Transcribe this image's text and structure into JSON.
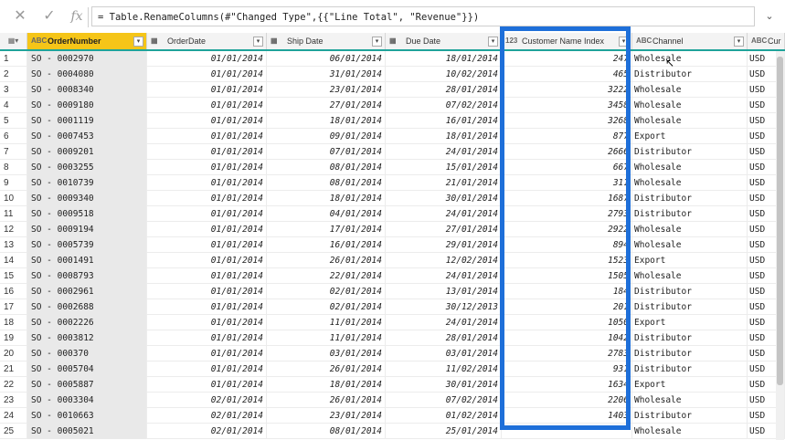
{
  "formula_bar": {
    "cancel_glyph": "✕",
    "confirm_glyph": "✓",
    "fx_label": "fx",
    "formula": "= Table.RenameColumns(#\"Changed Type\",{{\"Line Total\", \"Revenue\"}})",
    "expand_glyph": "⌄"
  },
  "columns": [
    {
      "type": "ABC",
      "label": "OrderNumber"
    },
    {
      "type": "▦",
      "label": "OrderDate"
    },
    {
      "type": "▦",
      "label": "Ship Date"
    },
    {
      "type": "▦",
      "label": "Due Date"
    },
    {
      "type": "123",
      "label": "Customer Name Index"
    },
    {
      "type": "ABC",
      "label": "Channel"
    },
    {
      "type": "ABC",
      "label": "Cur"
    }
  ],
  "rows": [
    {
      "n": "1",
      "order": "SO - 0002970",
      "od": "01/01/2014",
      "sd": "06/01/2014",
      "du": "18/01/2014",
      "cni": "247",
      "ch": "Wholesale",
      "cu": "USD"
    },
    {
      "n": "2",
      "order": "SO - 0004080",
      "od": "01/01/2014",
      "sd": "31/01/2014",
      "du": "10/02/2014",
      "cni": "465",
      "ch": "Distributor",
      "cu": "USD"
    },
    {
      "n": "3",
      "order": "SO - 0008340",
      "od": "01/01/2014",
      "sd": "23/01/2014",
      "du": "28/01/2014",
      "cni": "3222",
      "ch": "Wholesale",
      "cu": "USD"
    },
    {
      "n": "4",
      "order": "SO - 0009180",
      "od": "01/01/2014",
      "sd": "27/01/2014",
      "du": "07/02/2014",
      "cni": "3458",
      "ch": "Wholesale",
      "cu": "USD"
    },
    {
      "n": "5",
      "order": "SO - 0001119",
      "od": "01/01/2014",
      "sd": "18/01/2014",
      "du": "16/01/2014",
      "cni": "3268",
      "ch": "Wholesale",
      "cu": "USD"
    },
    {
      "n": "6",
      "order": "SO - 0007453",
      "od": "01/01/2014",
      "sd": "09/01/2014",
      "du": "18/01/2014",
      "cni": "877",
      "ch": "Export",
      "cu": "USD"
    },
    {
      "n": "7",
      "order": "SO - 0009201",
      "od": "01/01/2014",
      "sd": "07/01/2014",
      "du": "24/01/2014",
      "cni": "2666",
      "ch": "Distributor",
      "cu": "USD"
    },
    {
      "n": "8",
      "order": "SO - 0003255",
      "od": "01/01/2014",
      "sd": "08/01/2014",
      "du": "15/01/2014",
      "cni": "667",
      "ch": "Wholesale",
      "cu": "USD"
    },
    {
      "n": "9",
      "order": "SO - 0010739",
      "od": "01/01/2014",
      "sd": "08/01/2014",
      "du": "21/01/2014",
      "cni": "311",
      "ch": "Wholesale",
      "cu": "USD"
    },
    {
      "n": "10",
      "order": "SO - 0009340",
      "od": "01/01/2014",
      "sd": "18/01/2014",
      "du": "30/01/2014",
      "cni": "1687",
      "ch": "Distributor",
      "cu": "USD"
    },
    {
      "n": "11",
      "order": "SO - 0009518",
      "od": "01/01/2014",
      "sd": "04/01/2014",
      "du": "24/01/2014",
      "cni": "2793",
      "ch": "Distributor",
      "cu": "USD"
    },
    {
      "n": "12",
      "order": "SO - 0009194",
      "od": "01/01/2014",
      "sd": "17/01/2014",
      "du": "27/01/2014",
      "cni": "2922",
      "ch": "Wholesale",
      "cu": "USD"
    },
    {
      "n": "13",
      "order": "SO - 0005739",
      "od": "01/01/2014",
      "sd": "16/01/2014",
      "du": "29/01/2014",
      "cni": "894",
      "ch": "Wholesale",
      "cu": "USD"
    },
    {
      "n": "14",
      "order": "SO - 0001491",
      "od": "01/01/2014",
      "sd": "26/01/2014",
      "du": "12/02/2014",
      "cni": "1523",
      "ch": "Export",
      "cu": "USD"
    },
    {
      "n": "15",
      "order": "SO - 0008793",
      "od": "01/01/2014",
      "sd": "22/01/2014",
      "du": "24/01/2014",
      "cni": "1505",
      "ch": "Wholesale",
      "cu": "USD"
    },
    {
      "n": "16",
      "order": "SO - 0002961",
      "od": "01/01/2014",
      "sd": "02/01/2014",
      "du": "13/01/2014",
      "cni": "184",
      "ch": "Distributor",
      "cu": "USD"
    },
    {
      "n": "17",
      "order": "SO - 0002688",
      "od": "01/01/2014",
      "sd": "02/01/2014",
      "du": "30/12/2013",
      "cni": "201",
      "ch": "Distributor",
      "cu": "USD"
    },
    {
      "n": "18",
      "order": "SO - 0002226",
      "od": "01/01/2014",
      "sd": "11/01/2014",
      "du": "24/01/2014",
      "cni": "1050",
      "ch": "Export",
      "cu": "USD"
    },
    {
      "n": "19",
      "order": "SO - 0003812",
      "od": "01/01/2014",
      "sd": "11/01/2014",
      "du": "28/01/2014",
      "cni": "1042",
      "ch": "Distributor",
      "cu": "USD"
    },
    {
      "n": "20",
      "order": "SO - 000370",
      "od": "01/01/2014",
      "sd": "03/01/2014",
      "du": "03/01/2014",
      "cni": "2783",
      "ch": "Distributor",
      "cu": "USD"
    },
    {
      "n": "21",
      "order": "SO - 0005704",
      "od": "01/01/2014",
      "sd": "26/01/2014",
      "du": "11/02/2014",
      "cni": "931",
      "ch": "Distributor",
      "cu": "USD"
    },
    {
      "n": "22",
      "order": "SO - 0005887",
      "od": "01/01/2014",
      "sd": "18/01/2014",
      "du": "30/01/2014",
      "cni": "1634",
      "ch": "Export",
      "cu": "USD"
    },
    {
      "n": "23",
      "order": "SO - 0003304",
      "od": "02/01/2014",
      "sd": "26/01/2014",
      "du": "07/02/2014",
      "cni": "2206",
      "ch": "Wholesale",
      "cu": "USD"
    },
    {
      "n": "24",
      "order": "SO - 0010663",
      "od": "02/01/2014",
      "sd": "23/01/2014",
      "du": "01/02/2014",
      "cni": "1403",
      "ch": "Distributor",
      "cu": "USD"
    },
    {
      "n": "25",
      "order": "SO - 0005021",
      "od": "02/01/2014",
      "sd": "08/01/2014",
      "du": "25/01/2014",
      "cni": "",
      "ch": "Wholesale",
      "cu": "USD"
    }
  ],
  "colors": {
    "accent": "#1fa39a",
    "selected_header": "#f5c518",
    "highlight_box": "#1e6fd9"
  }
}
